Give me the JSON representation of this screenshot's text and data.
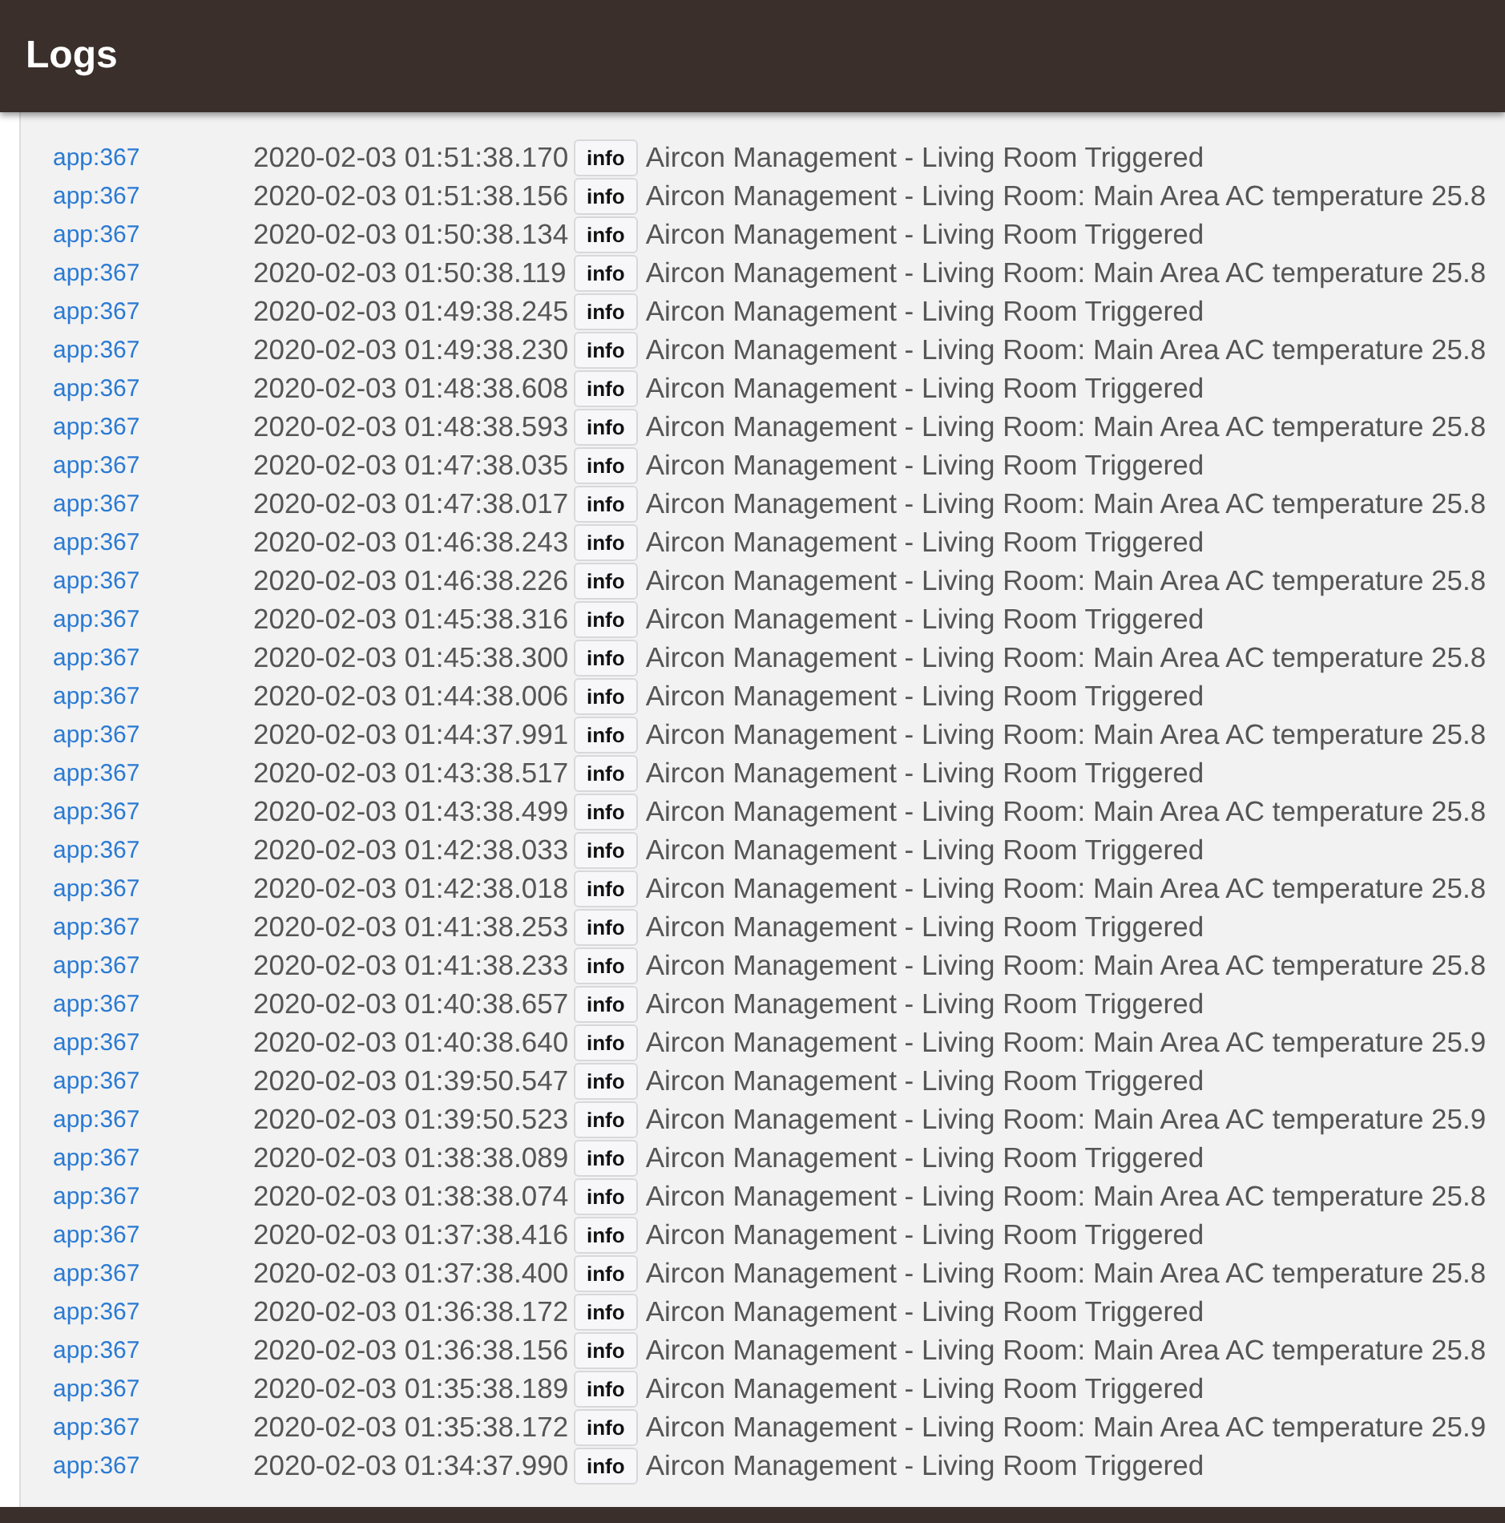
{
  "header": {
    "title": "Logs"
  },
  "rows": [
    {
      "source": "app:367",
      "time": "2020-02-03 01:51:38.170",
      "level": "info",
      "message": "Aircon Management - Living Room Triggered"
    },
    {
      "source": "app:367",
      "time": "2020-02-03 01:51:38.156",
      "level": "info",
      "message": "Aircon Management - Living Room: Main Area AC temperature 25.8"
    },
    {
      "source": "app:367",
      "time": "2020-02-03 01:50:38.134",
      "level": "info",
      "message": "Aircon Management - Living Room Triggered"
    },
    {
      "source": "app:367",
      "time": "2020-02-03 01:50:38.119",
      "level": "info",
      "message": "Aircon Management - Living Room: Main Area AC temperature 25.8"
    },
    {
      "source": "app:367",
      "time": "2020-02-03 01:49:38.245",
      "level": "info",
      "message": "Aircon Management - Living Room Triggered"
    },
    {
      "source": "app:367",
      "time": "2020-02-03 01:49:38.230",
      "level": "info",
      "message": "Aircon Management - Living Room: Main Area AC temperature 25.8"
    },
    {
      "source": "app:367",
      "time": "2020-02-03 01:48:38.608",
      "level": "info",
      "message": "Aircon Management - Living Room Triggered"
    },
    {
      "source": "app:367",
      "time": "2020-02-03 01:48:38.593",
      "level": "info",
      "message": "Aircon Management - Living Room: Main Area AC temperature 25.8"
    },
    {
      "source": "app:367",
      "time": "2020-02-03 01:47:38.035",
      "level": "info",
      "message": "Aircon Management - Living Room Triggered"
    },
    {
      "source": "app:367",
      "time": "2020-02-03 01:47:38.017",
      "level": "info",
      "message": "Aircon Management - Living Room: Main Area AC temperature 25.8"
    },
    {
      "source": "app:367",
      "time": "2020-02-03 01:46:38.243",
      "level": "info",
      "message": "Aircon Management - Living Room Triggered"
    },
    {
      "source": "app:367",
      "time": "2020-02-03 01:46:38.226",
      "level": "info",
      "message": "Aircon Management - Living Room: Main Area AC temperature 25.8"
    },
    {
      "source": "app:367",
      "time": "2020-02-03 01:45:38.316",
      "level": "info",
      "message": "Aircon Management - Living Room Triggered"
    },
    {
      "source": "app:367",
      "time": "2020-02-03 01:45:38.300",
      "level": "info",
      "message": "Aircon Management - Living Room: Main Area AC temperature 25.8"
    },
    {
      "source": "app:367",
      "time": "2020-02-03 01:44:38.006",
      "level": "info",
      "message": "Aircon Management - Living Room Triggered"
    },
    {
      "source": "app:367",
      "time": "2020-02-03 01:44:37.991",
      "level": "info",
      "message": "Aircon Management - Living Room: Main Area AC temperature 25.8"
    },
    {
      "source": "app:367",
      "time": "2020-02-03 01:43:38.517",
      "level": "info",
      "message": "Aircon Management - Living Room Triggered"
    },
    {
      "source": "app:367",
      "time": "2020-02-03 01:43:38.499",
      "level": "info",
      "message": "Aircon Management - Living Room: Main Area AC temperature 25.8"
    },
    {
      "source": "app:367",
      "time": "2020-02-03 01:42:38.033",
      "level": "info",
      "message": "Aircon Management - Living Room Triggered"
    },
    {
      "source": "app:367",
      "time": "2020-02-03 01:42:38.018",
      "level": "info",
      "message": "Aircon Management - Living Room: Main Area AC temperature 25.8"
    },
    {
      "source": "app:367",
      "time": "2020-02-03 01:41:38.253",
      "level": "info",
      "message": "Aircon Management - Living Room Triggered"
    },
    {
      "source": "app:367",
      "time": "2020-02-03 01:41:38.233",
      "level": "info",
      "message": "Aircon Management - Living Room: Main Area AC temperature 25.8"
    },
    {
      "source": "app:367",
      "time": "2020-02-03 01:40:38.657",
      "level": "info",
      "message": "Aircon Management - Living Room Triggered"
    },
    {
      "source": "app:367",
      "time": "2020-02-03 01:40:38.640",
      "level": "info",
      "message": "Aircon Management - Living Room: Main Area AC temperature 25.9"
    },
    {
      "source": "app:367",
      "time": "2020-02-03 01:39:50.547",
      "level": "info",
      "message": "Aircon Management - Living Room Triggered"
    },
    {
      "source": "app:367",
      "time": "2020-02-03 01:39:50.523",
      "level": "info",
      "message": "Aircon Management - Living Room: Main Area AC temperature 25.9"
    },
    {
      "source": "app:367",
      "time": "2020-02-03 01:38:38.089",
      "level": "info",
      "message": "Aircon Management - Living Room Triggered"
    },
    {
      "source": "app:367",
      "time": "2020-02-03 01:38:38.074",
      "level": "info",
      "message": "Aircon Management - Living Room: Main Area AC temperature 25.8"
    },
    {
      "source": "app:367",
      "time": "2020-02-03 01:37:38.416",
      "level": "info",
      "message": "Aircon Management - Living Room Triggered"
    },
    {
      "source": "app:367",
      "time": "2020-02-03 01:37:38.400",
      "level": "info",
      "message": "Aircon Management - Living Room: Main Area AC temperature 25.8"
    },
    {
      "source": "app:367",
      "time": "2020-02-03 01:36:38.172",
      "level": "info",
      "message": "Aircon Management - Living Room Triggered"
    },
    {
      "source": "app:367",
      "time": "2020-02-03 01:36:38.156",
      "level": "info",
      "message": "Aircon Management - Living Room: Main Area AC temperature 25.8"
    },
    {
      "source": "app:367",
      "time": "2020-02-03 01:35:38.189",
      "level": "info",
      "message": "Aircon Management - Living Room Triggered"
    },
    {
      "source": "app:367",
      "time": "2020-02-03 01:35:38.172",
      "level": "info",
      "message": "Aircon Management - Living Room: Main Area AC temperature 25.9"
    },
    {
      "source": "app:367",
      "time": "2020-02-03 01:34:37.990",
      "level": "info",
      "message": "Aircon Management - Living Room Triggered"
    }
  ]
}
